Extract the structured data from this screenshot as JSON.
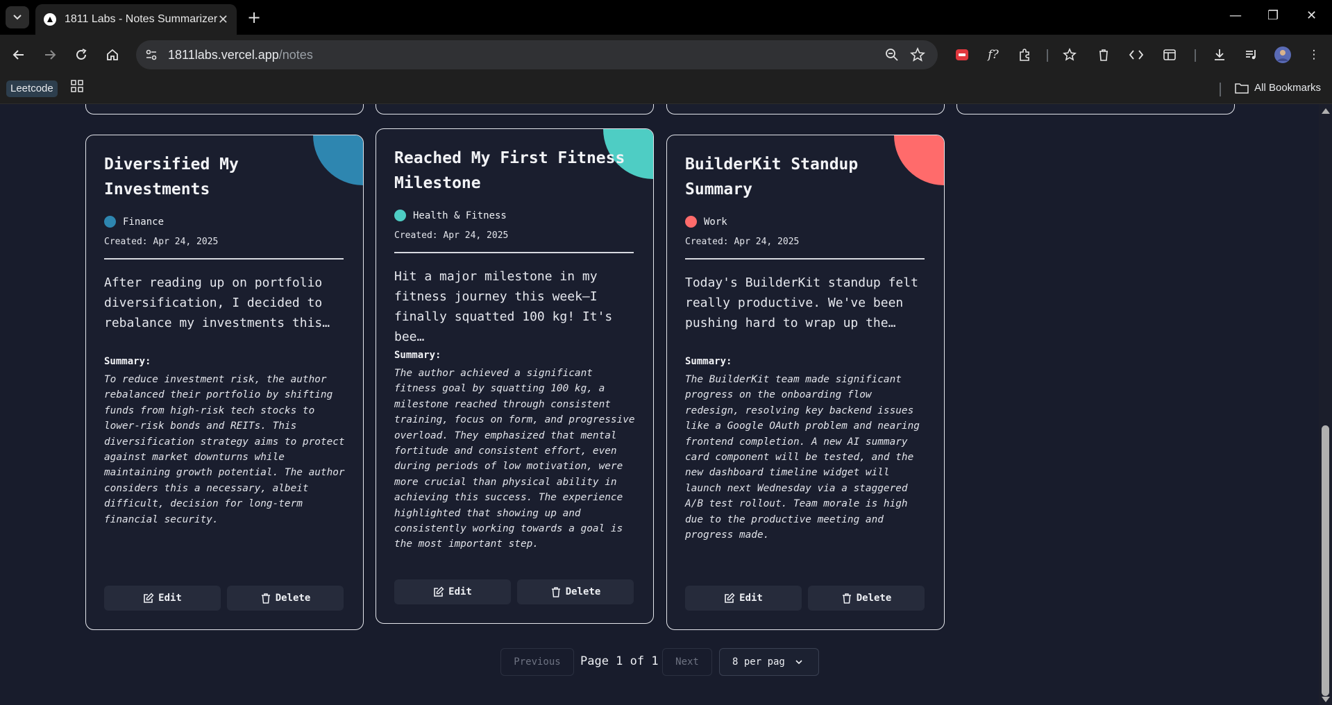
{
  "browser": {
    "tab_title": "1811 Labs - Notes Summarizer",
    "url_host": "1811labs.vercel.app",
    "url_path": "/notes",
    "bookmark_leetcode": "Leetcode",
    "all_bookmarks": "All Bookmarks"
  },
  "notes": [
    {
      "title": "Diversified My Investments",
      "category": "Finance",
      "category_color": "#2e86b0",
      "created": "Created: Apr 24, 2025",
      "body": "After reading up on portfolio diversification, I decided to rebalance my investments this…",
      "summary_label": "Summary:",
      "summary": "To reduce investment risk, the author rebalanced their portfolio by shifting funds from high-risk tech stocks to lower-risk bonds and REITs. This diversification strategy aims to protect against market downturns while maintaining growth potential. The author considers this a necessary, albeit difficult, decision for long-term financial security.",
      "edit_label": "Edit",
      "delete_label": "Delete"
    },
    {
      "title": "Reached My First Fitness Milestone",
      "category": "Health & Fitness",
      "category_color": "#4ecdc4",
      "created": "Created: Apr 24, 2025",
      "body": "Hit a major milestone in my fitness journey this week—I finally squatted 100 kg! It's bee…",
      "summary_label": "Summary:",
      "summary": "The author achieved a significant fitness goal by squatting 100 kg, a milestone reached through consistent training, focus on form, and progressive overload. They emphasized that mental fortitude and consistent effort, even during periods of low motivation, were more crucial than physical ability in achieving this success. The experience highlighted that showing up and consistently working towards a goal is the most important step.",
      "edit_label": "Edit",
      "delete_label": "Delete"
    },
    {
      "title": "BuilderKit Standup Summary",
      "category": "Work",
      "category_color": "#ff6b6b",
      "created": "Created: Apr 24, 2025",
      "body": "Today's BuilderKit standup felt really productive. We've been pushing hard to wrap up the…",
      "summary_label": "Summary:",
      "summary": "The BuilderKit team made significant progress on the onboarding flow redesign, resolving key backend issues like a Google OAuth problem and nearing frontend completion. A new AI summary card component will be tested, and the new dashboard timeline widget will launch next Wednesday via a staggered A/B test rollout. Team morale is high due to the productive meeting and progress made.",
      "edit_label": "Edit",
      "delete_label": "Delete"
    }
  ],
  "pagination": {
    "previous": "Previous",
    "page_text": "Page 1 of 1",
    "next": "Next",
    "per_page": "8 per pag"
  }
}
